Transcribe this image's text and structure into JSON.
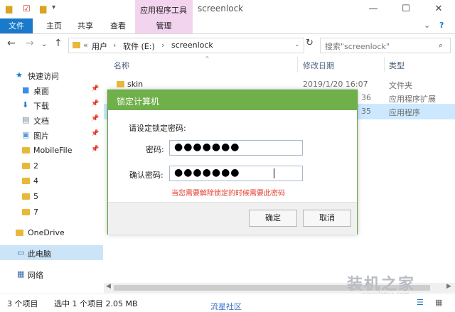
{
  "window": {
    "title": "screenlock",
    "context_tab_group": "应用程序工具",
    "controls": {
      "minimize": "—",
      "maximize": "☐",
      "close": "✕",
      "help": "?"
    }
  },
  "ribbon": {
    "tabs": [
      "文件",
      "主页",
      "共享",
      "查看",
      "管理"
    ]
  },
  "address": {
    "prefix": "«",
    "crumbs": [
      "用户",
      "软件 (E:)",
      "screenlock"
    ],
    "separator": "›",
    "search_placeholder": "搜索\"screenlock\""
  },
  "nav_pane": {
    "items": [
      {
        "label": "快速访问"
      },
      {
        "label": "桌面"
      },
      {
        "label": "下载"
      },
      {
        "label": "文档"
      },
      {
        "label": "图片"
      },
      {
        "label": "MobileFile"
      },
      {
        "label": "2"
      },
      {
        "label": "4"
      },
      {
        "label": "5"
      },
      {
        "label": "7"
      },
      {
        "label": "OneDrive"
      },
      {
        "label": "此电脑"
      },
      {
        "label": "网络"
      }
    ]
  },
  "file_list": {
    "columns": [
      "名称",
      "修改日期",
      "类型"
    ],
    "rows": [
      {
        "name": "skin",
        "date": "2019/1/20 16:07",
        "type": "文件夹"
      },
      {
        "name": "",
        "date": "36",
        "type": "应用程序扩展"
      },
      {
        "name": "",
        "date": "35",
        "type": "应用程序"
      }
    ]
  },
  "dialog": {
    "title": "锁定计算机",
    "prompt": "请设定锁定密码:",
    "password_label": "密码:",
    "password_value": "●●●●●●●",
    "confirm_label": "确认密码:",
    "confirm_value": "●●●●●●●",
    "hint": "当您需要解除锁定的时候需要此密码",
    "ok_label": "确定",
    "cancel_label": "取消"
  },
  "status_bar": {
    "item_count": "3 个项目",
    "selection": "选中 1 个项目  2.05 MB"
  },
  "watermark": {
    "text": "装机之家",
    "url": "www.lotpc.com",
    "bottom_text": "流星社区"
  },
  "colors": {
    "accent": "#1979ca",
    "context_tab": "#f3d4ef",
    "dialog_title": "#70b04a",
    "hint": "#e13b2b"
  }
}
